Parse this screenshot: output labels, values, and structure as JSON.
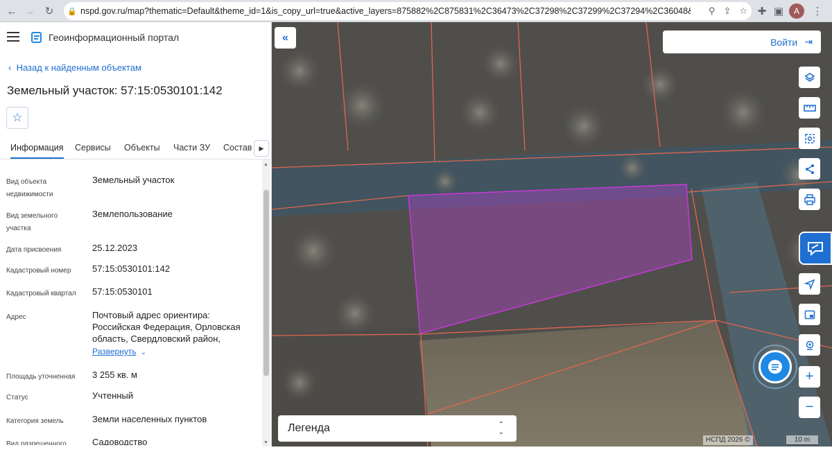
{
  "browser": {
    "url": "nspd.gov.ru/map?thematic=Default&theme_id=1&is_copy_url=true&active_layers=875882%2C875831%2C36473%2C37298%2C37299%2C37294%2C36048&...",
    "avatar_letter": "A"
  },
  "header": {
    "menu_icon": "hamburger-icon",
    "title": "Геоинформационный портал"
  },
  "object": {
    "back_link": "Назад к найденным объектам",
    "title": "Земельный участок: 57:15:0530101:142",
    "favorite_icon": "star-icon"
  },
  "tabs": [
    {
      "label": "Информация",
      "active": true
    },
    {
      "label": "Сервисы",
      "active": false
    },
    {
      "label": "Объекты",
      "active": false
    },
    {
      "label": "Части ЗУ",
      "active": false
    },
    {
      "label": "Состав",
      "active": false
    }
  ],
  "info": [
    {
      "label": "Вид объекта недвижимости",
      "value": "Земельный участок"
    },
    {
      "label": "Вид земельного участка",
      "value": "Землепользование"
    },
    {
      "label": "Дата присвоения",
      "value": "25.12.2023"
    },
    {
      "label": "Кадастровый номер",
      "value": "57:15:0530101:142"
    },
    {
      "label": "Кадастровый квартал",
      "value": "57:15:0530101"
    },
    {
      "label": "Адрес",
      "value": "Почтовый адрес ориентира: Российская Федерация, Орловская область, Свердловский район,",
      "expand": "Развернуть"
    },
    {
      "label": "Площадь уточненная",
      "value": "3 255 кв. м"
    },
    {
      "label": "Статус",
      "value": "Учтенный"
    },
    {
      "label": "Категория земель",
      "value": "Земли населенных пунктов"
    },
    {
      "label": "Вид разрешенного",
      "value": "Садоводство"
    }
  ],
  "map": {
    "login_label": "Войти",
    "legend_label": "Легенда",
    "attribution": "НСПД 2026 ©",
    "scale_label": "10 m",
    "tools": [
      "layers-icon",
      "ruler-icon",
      "select-area-icon",
      "share-icon",
      "print-icon",
      "locate-icon",
      "minimap-icon",
      "geo-pin-icon",
      "zoom-in-icon",
      "zoom-out-icon"
    ],
    "parcel_color": "#b042c8",
    "boundary_color": "#e0674f"
  }
}
